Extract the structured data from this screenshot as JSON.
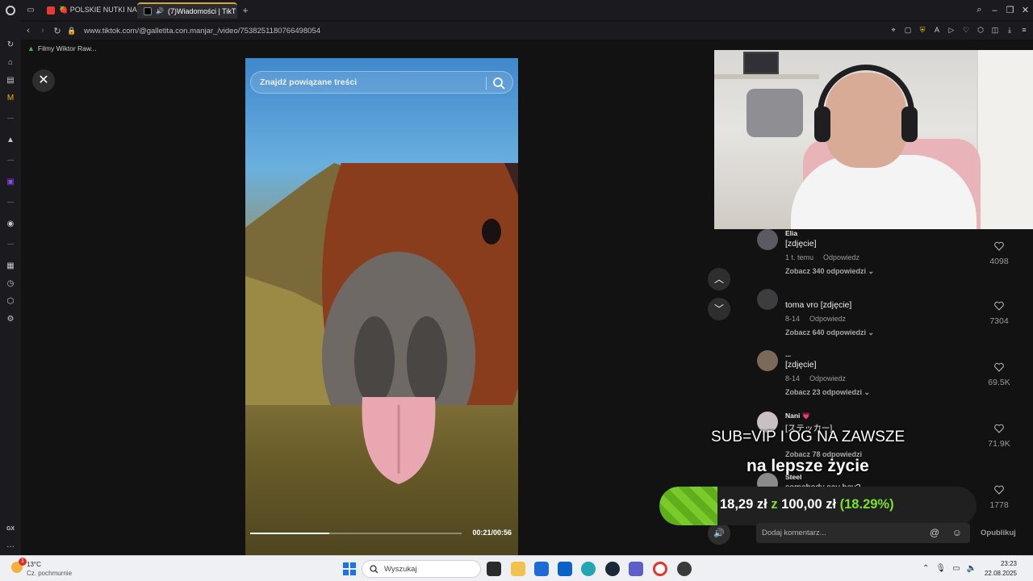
{
  "browser": {
    "tabs": [
      {
        "label": "🍓 POLSKIE NUTKI NA",
        "active": false
      },
      {
        "label": "(7)Wiadomości | TikT",
        "active": true
      }
    ],
    "new_tab": "+",
    "url": "www.tiktok.com/@galletita.con.manjar_/video/7538251180766498054",
    "bookmark": "Filmy Wiktor Raw..."
  },
  "video": {
    "search_placeholder": "Znajdź powiązane treści",
    "time": "00:21/00:56",
    "progress": 0.375
  },
  "comments": [
    {
      "user": "Elia",
      "text": "[zdjęcie]",
      "time": "1 t. temu",
      "reply": "Odpowiedz",
      "replies": "Zobacz 340 odpowiedzi",
      "likes": "4098"
    },
    {
      "user": "",
      "text": "toma vro [zdjęcie]",
      "time": "8-14",
      "reply": "Odpowiedz",
      "replies": "Zobacz 640 odpowiedzi",
      "likes": "7304"
    },
    {
      "user": "...",
      "text": "[zdjęcie]",
      "time": "8-14",
      "reply": "Odpowiedz",
      "replies": "Zobacz 23 odpowiedzi",
      "likes": "69.5K"
    },
    {
      "user": "Nani 💗",
      "text": "[ステッカー]",
      "time": "",
      "reply": "",
      "replies": "Zobacz 78 odpowiedzi",
      "likes": "71.9K"
    },
    {
      "user": "Steel",
      "text": "somebody say hey?",
      "time": "",
      "reply": "",
      "replies": "",
      "likes": "1778"
    }
  ],
  "comment_input": {
    "placeholder": "Dodaj komentarz...",
    "publish": "Opublikuj"
  },
  "overlay": {
    "sub_text": "SUB=VIP I OG  NA ZAWSZE",
    "better_text": "na lepsze życie",
    "donation": {
      "current": "18,29 zł",
      "sep": "z",
      "goal": "100,00 zł",
      "percent": "(18.29%)",
      "fraction": 0.1829
    }
  },
  "taskbar": {
    "weather_temp": "13°C",
    "weather_cond": "Cz. pochmurnie",
    "weather_badge": "1",
    "search": "Wyszukaj",
    "time": "23:23",
    "date": "22.08.2025"
  }
}
